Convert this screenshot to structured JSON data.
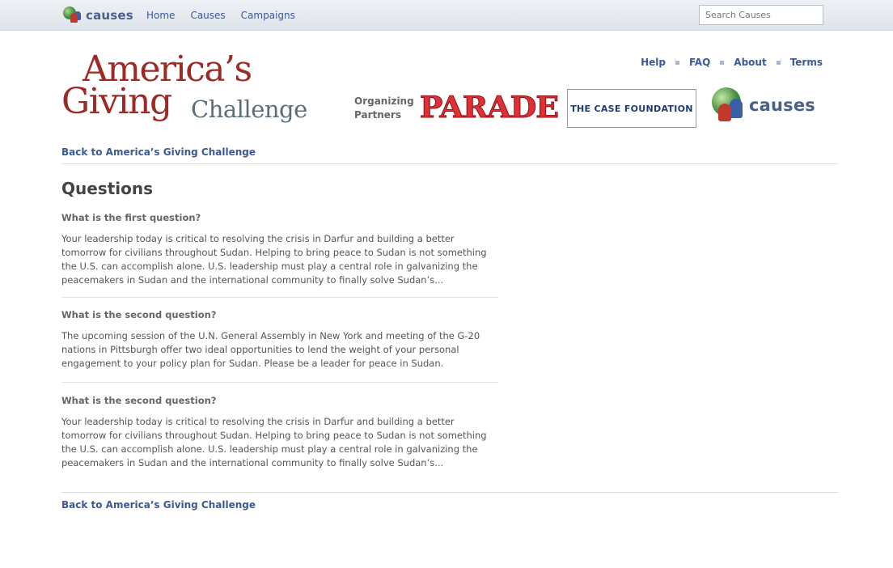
{
  "topbar": {
    "logo_text": "causes",
    "nav": [
      "Home",
      "Causes",
      "Campaigns"
    ],
    "search_placeholder": "Search Causes"
  },
  "header": {
    "brand_line1": "America’s",
    "brand_line2": "Giving",
    "brand_line3": "Challenge",
    "help_links": [
      "Help",
      "FAQ",
      "About",
      "Terms"
    ],
    "partners_label_1": "Organizing",
    "partners_label_2": "Partners",
    "parade_logo": "PARADE",
    "case_logo": "THE CASE FOUNDATION",
    "causes_logo": "causes"
  },
  "back_link": "Back to America’s Giving Challenge",
  "main": {
    "title": "Questions",
    "questions": [
      {
        "q": "What is the first question?",
        "a": "Your leadership today is critical to resolving the crisis in Darfur and building a better tomorrow for civilians throughout Sudan. Helping to bring peace to Sudan is not something the U.S. can accomplish alone. U.S. leadership must play a central role in galvanizing the peacemakers in Sudan and the international community to finally solve Sudan’s..."
      },
      {
        "q": "What is the second question?",
        "a": "The upcoming session of the U.N. General Assembly in New York and meeting of the G-20 nations in Pittsburgh offer two ideal opportunities to lend the weight of your personal engagement to your policy plan for Sudan. Please be a leader for peace in Sudan."
      },
      {
        "q": "What is the second question?",
        "a": "Your leadership today is critical to resolving the crisis in Darfur and building a better tomorrow for civilians throughout Sudan. Helping to bring peace to Sudan is not something the U.S. can accomplish alone. U.S. leadership must play a central role in galvanizing the peacemakers in Sudan and the international community to finally solve Sudan’s..."
      }
    ]
  },
  "colors": {
    "link": "#3b5998",
    "brand_red": "#9c2a25",
    "parade_red": "#e03036"
  }
}
